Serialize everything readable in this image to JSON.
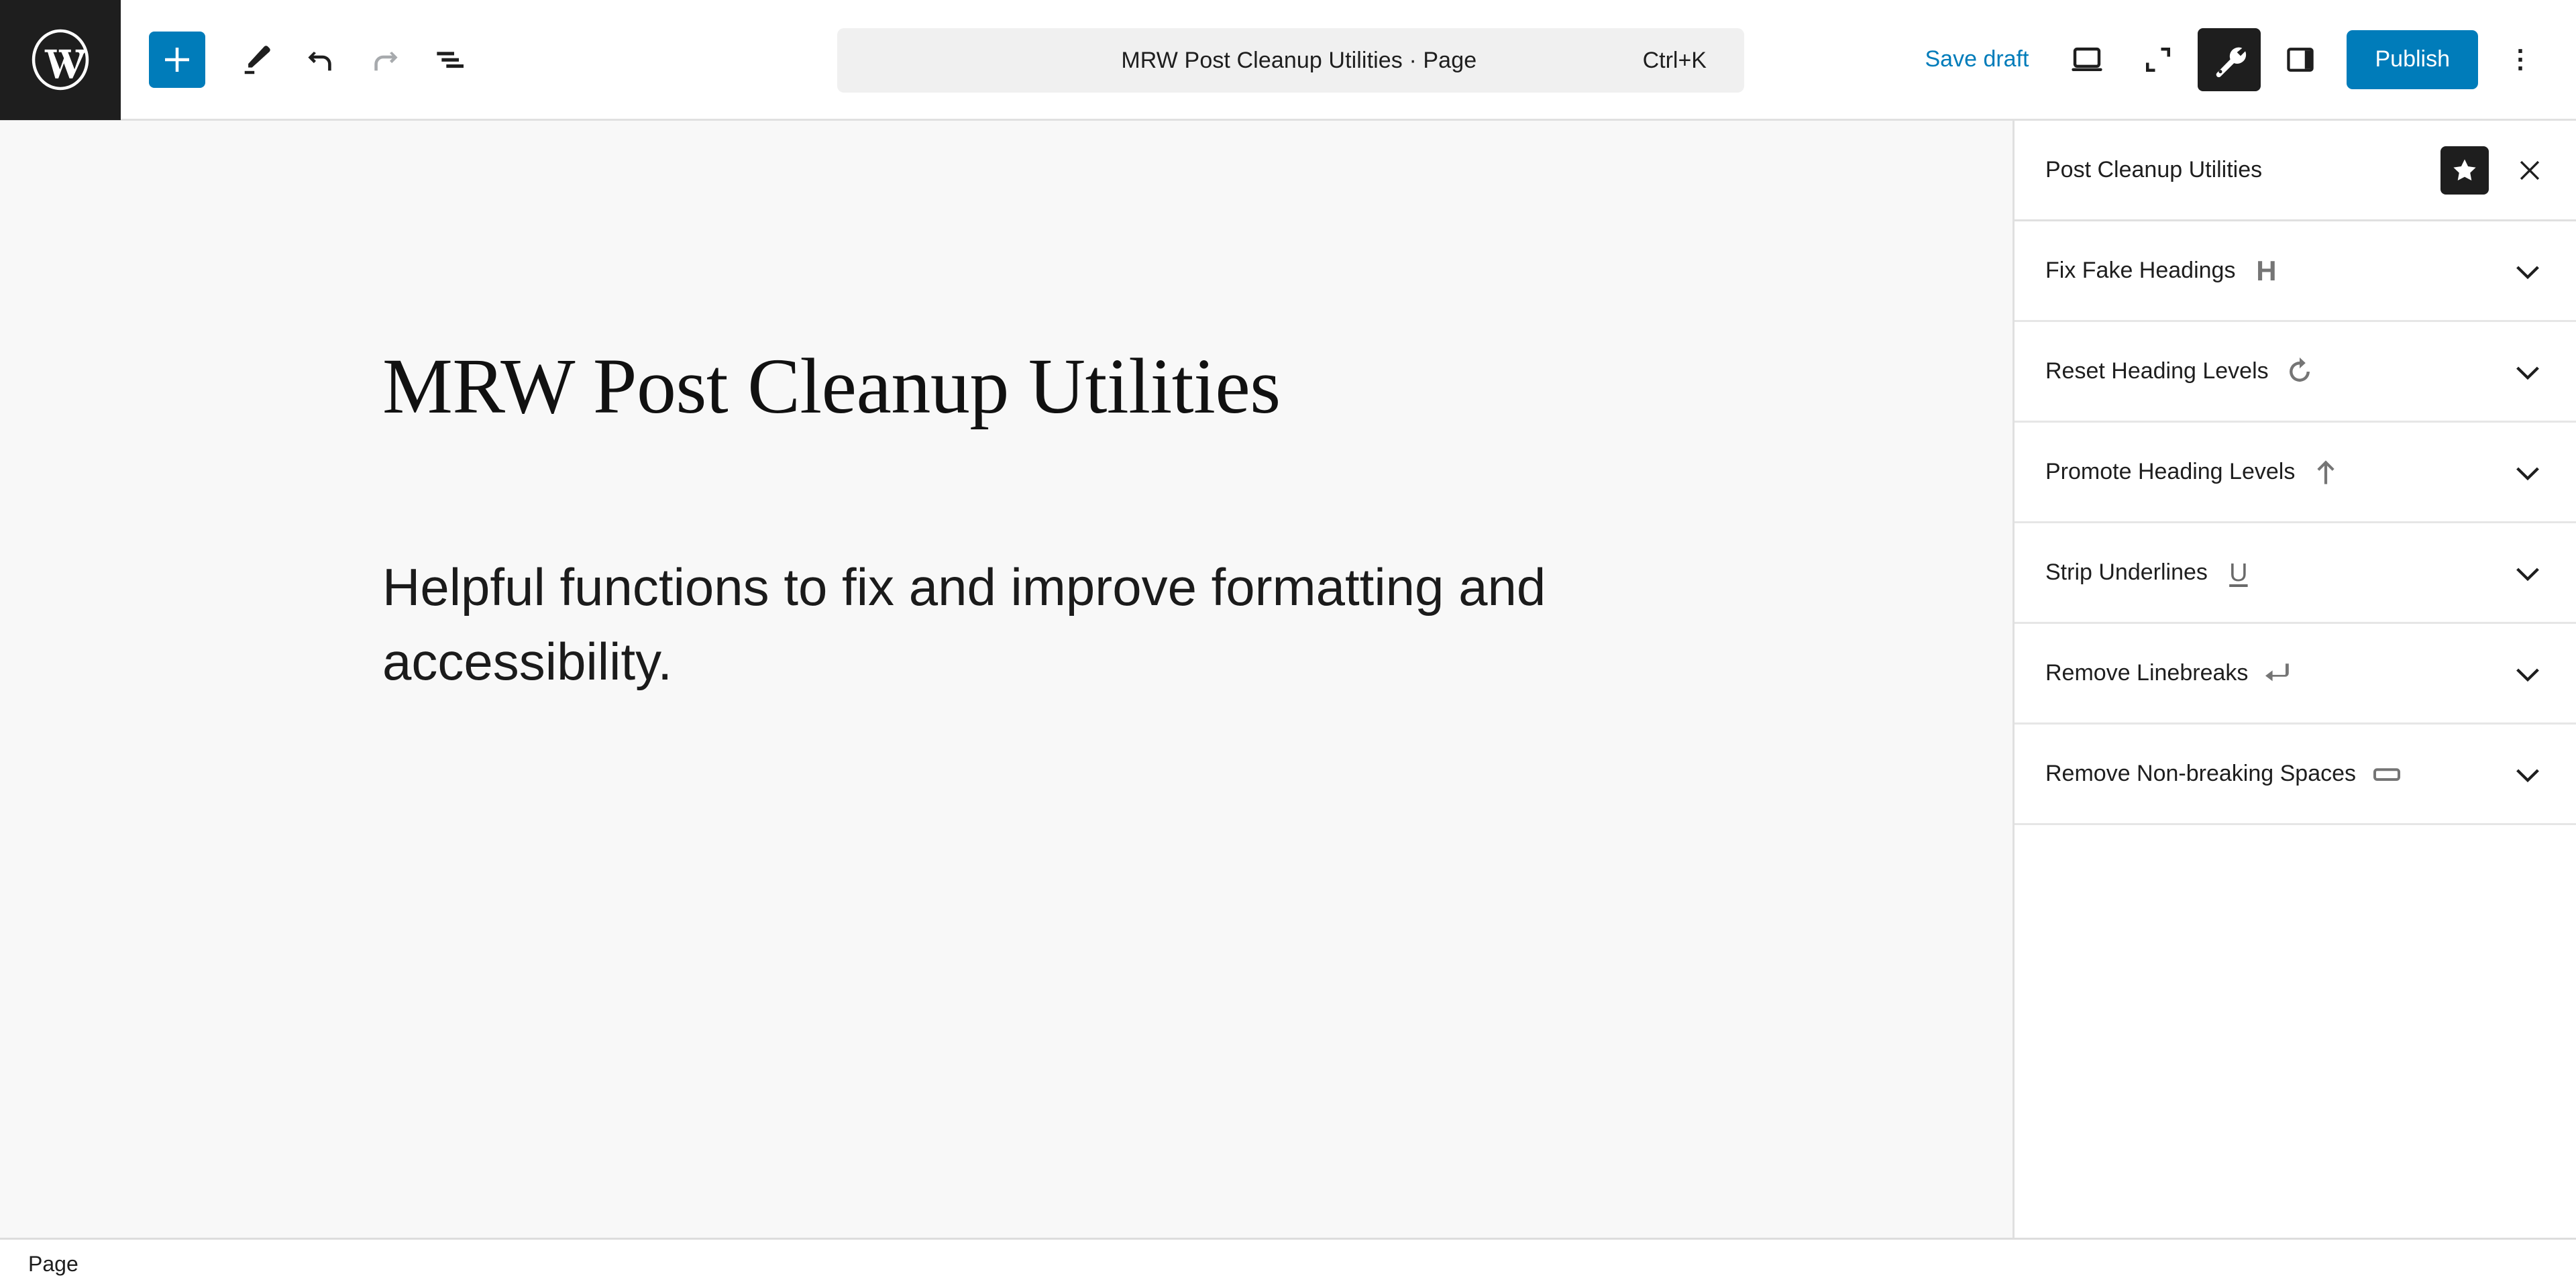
{
  "header": {
    "logo_icon": "wordpress-logo-icon",
    "add_block_label": "+",
    "add_block_icon": "plus-icon",
    "tools": [
      {
        "name": "edit-tool",
        "icon": "pencil-icon",
        "disabled": false
      },
      {
        "name": "undo",
        "icon": "undo-arrow-icon",
        "disabled": false
      },
      {
        "name": "redo",
        "icon": "redo-arrow-icon",
        "disabled": true
      },
      {
        "name": "document-overview",
        "icon": "list-view-icon",
        "disabled": false
      }
    ],
    "command_bar": {
      "title": "MRW Post Cleanup Utilities · Page",
      "shortcut": "Ctrl+K"
    },
    "save_draft_label": "Save draft",
    "view_icons": [
      {
        "name": "preview-device",
        "icon": "desktop-icon",
        "active": false
      },
      {
        "name": "zoom-out-view",
        "icon": "fullscreen-corners-icon",
        "active": false
      },
      {
        "name": "plugin-tools",
        "icon": "wrench-icon",
        "active": true
      },
      {
        "name": "settings-sidebar",
        "icon": "sidebar-panel-icon",
        "active": false
      }
    ],
    "publish_label": "Publish",
    "options_icon": "three-dots-vertical-icon"
  },
  "canvas": {
    "post_title": "MRW Post Cleanup Utilities",
    "post_paragraph": "Helpful functions to fix and improve formatting and accessibility."
  },
  "sidebar": {
    "title": "Post Cleanup Utilities",
    "pin_icon": "star-filled-icon",
    "close_icon": "close-x-icon",
    "panels": [
      {
        "label": "Fix Fake Headings",
        "icon": "heading-h-icon",
        "chevron": "chevron-down-icon"
      },
      {
        "label": "Reset Heading Levels",
        "icon": "rotate-ccw-icon",
        "chevron": "chevron-down-icon"
      },
      {
        "label": "Promote Heading Levels",
        "icon": "arrow-up-icon",
        "chevron": "chevron-down-icon"
      },
      {
        "label": "Strip Underlines",
        "icon": "underline-u-icon",
        "chevron": "chevron-down-icon"
      },
      {
        "label": "Remove Linebreaks",
        "icon": "return-enter-arrow-icon",
        "chevron": "chevron-down-icon"
      },
      {
        "label": "Remove Non-breaking Spaces",
        "icon": "spacebar-icon",
        "chevron": "chevron-down-icon"
      }
    ]
  },
  "footer": {
    "breadcrumb_label": "Page"
  },
  "colors": {
    "accent_blue": "#007cba",
    "dark": "#1e1e1e",
    "canvas_bg": "#f8f8f8",
    "border": "#e0e0e0",
    "icon_muted": "#757575",
    "disabled": "#a7aaad"
  }
}
